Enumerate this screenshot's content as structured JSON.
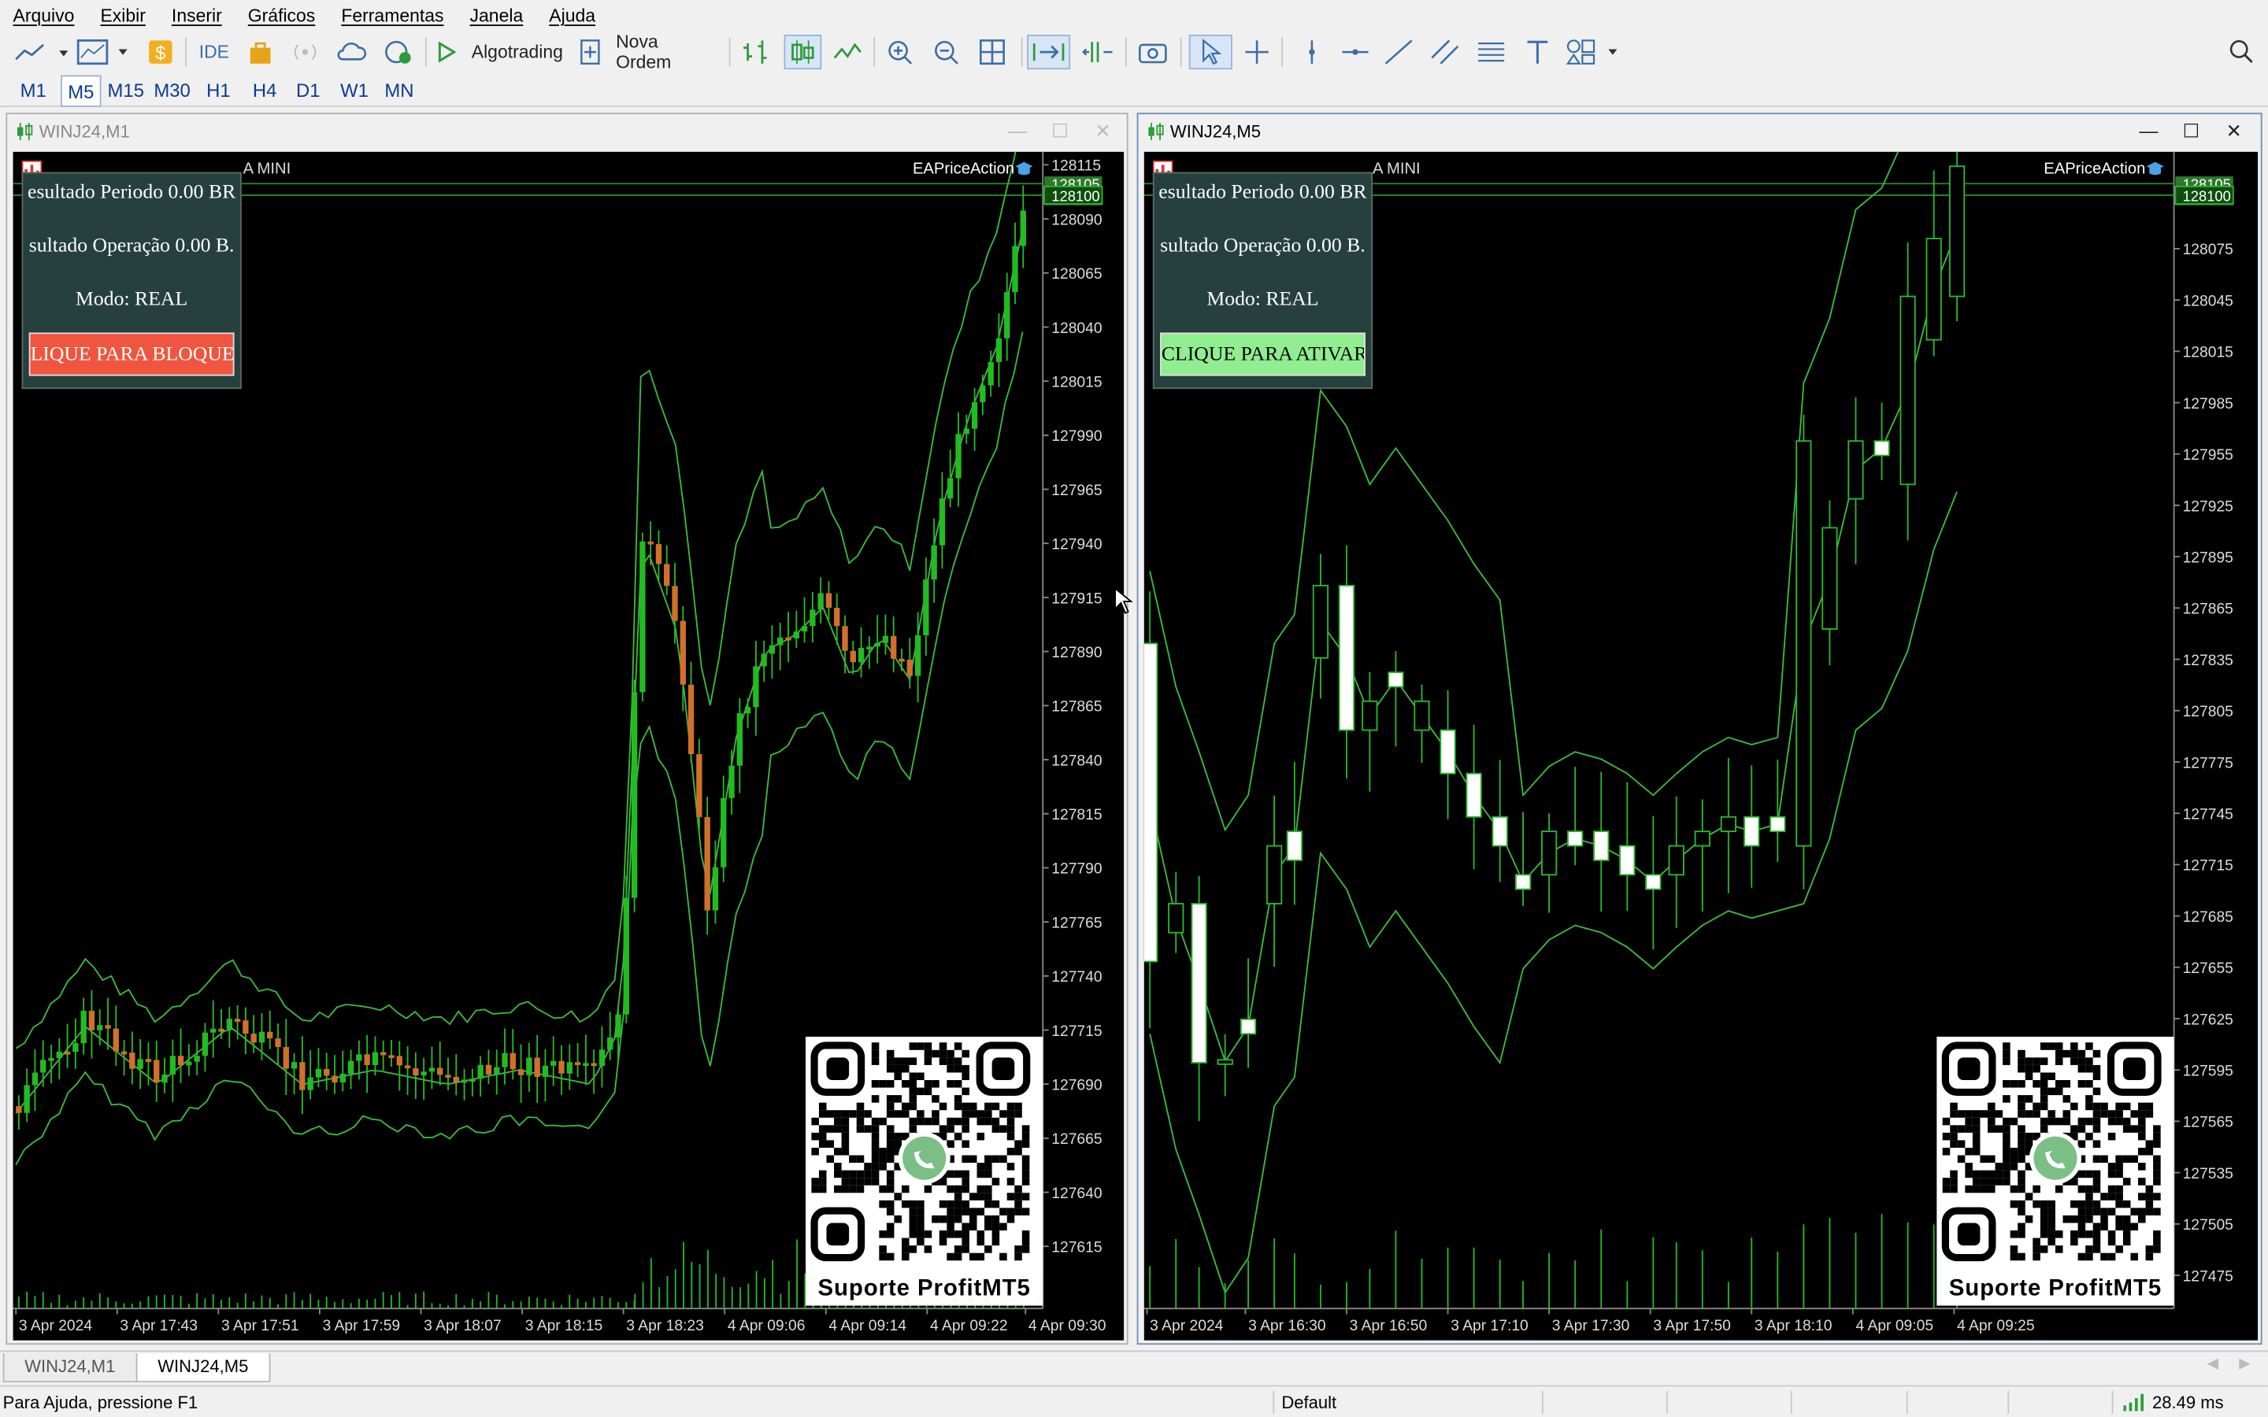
{
  "menu": [
    "Arquivo",
    "Exibir",
    "Inserir",
    "Gráficos",
    "Ferramentas",
    "Janela",
    "Ajuda"
  ],
  "toolbar": {
    "ide_label": "IDE",
    "algotrading_label": "Algotrading",
    "nova_ordem_label": "Nova Ordem"
  },
  "timeframes": [
    "M1",
    "M5",
    "M15",
    "M30",
    "H1",
    "H4",
    "D1",
    "W1",
    "MN"
  ],
  "active_timeframe": "M5",
  "windows": [
    {
      "title": "WINJ24,M1",
      "symbol_label": "A MINI",
      "ea_name": "EAPriceAction",
      "panel": {
        "line1": "esultado Periodo 0.00 BR",
        "line2": "sultado Operação 0.00 B.",
        "line3": "Modo: REAL",
        "button": "LIQUE PARA BLOQUEA",
        "button_color": "#f0553f"
      },
      "price_labels": [
        "128115",
        "128090",
        "128065",
        "128040",
        "128015",
        "127990",
        "127965",
        "127940",
        "127915",
        "127890",
        "127865",
        "127840",
        "127815",
        "127790",
        "127765",
        "127740",
        "127715",
        "127690",
        "127665",
        "127640",
        "127615"
      ],
      "current_price": [
        "128105",
        "128100"
      ],
      "time_labels": [
        "3 Apr 2024",
        "3 Apr 17:43",
        "3 Apr 17:51",
        "3 Apr 17:59",
        "3 Apr 18:07",
        "3 Apr 18:15",
        "3 Apr 18:23",
        "4 Apr 09:06",
        "4 Apr 09:14",
        "4 Apr 09:22",
        "4 Apr 09:30"
      ],
      "qr_caption": "Suporte ProfitMT5"
    },
    {
      "title": "WINJ24,M5",
      "symbol_label": "A MINI",
      "ea_name": "EAPriceAction",
      "panel": {
        "line1": "esultado Periodo 0.00 BR",
        "line2": "sultado Operação 0.00 B.",
        "line3": "Modo: REAL",
        "button": "CLIQUE PARA ATIVAR",
        "button_color": "#90ee90"
      },
      "price_labels": [
        "128075",
        "128045",
        "128015",
        "127985",
        "127955",
        "127925",
        "127895",
        "127865",
        "127835",
        "127805",
        "127775",
        "127745",
        "127715",
        "127685",
        "127655",
        "127625",
        "127595",
        "127565",
        "127535",
        "127505",
        "127475"
      ],
      "current_price": [
        "128105",
        "128100"
      ],
      "time_labels": [
        "3 Apr 2024",
        "3 Apr 16:30",
        "3 Apr 16:50",
        "3 Apr 17:10",
        "3 Apr 17:30",
        "3 Apr 17:50",
        "3 Apr 18:10",
        "4 Apr 09:05",
        "4 Apr 09:25"
      ],
      "qr_caption": "Suporte ProfitMT5"
    }
  ],
  "tabs": [
    "WINJ24,M1",
    "WINJ24,M5"
  ],
  "active_tab": "WINJ24,M5",
  "status": {
    "help": "Para Ajuda, pressione F1",
    "profile": "Default",
    "ping": "28.49 ms"
  }
}
